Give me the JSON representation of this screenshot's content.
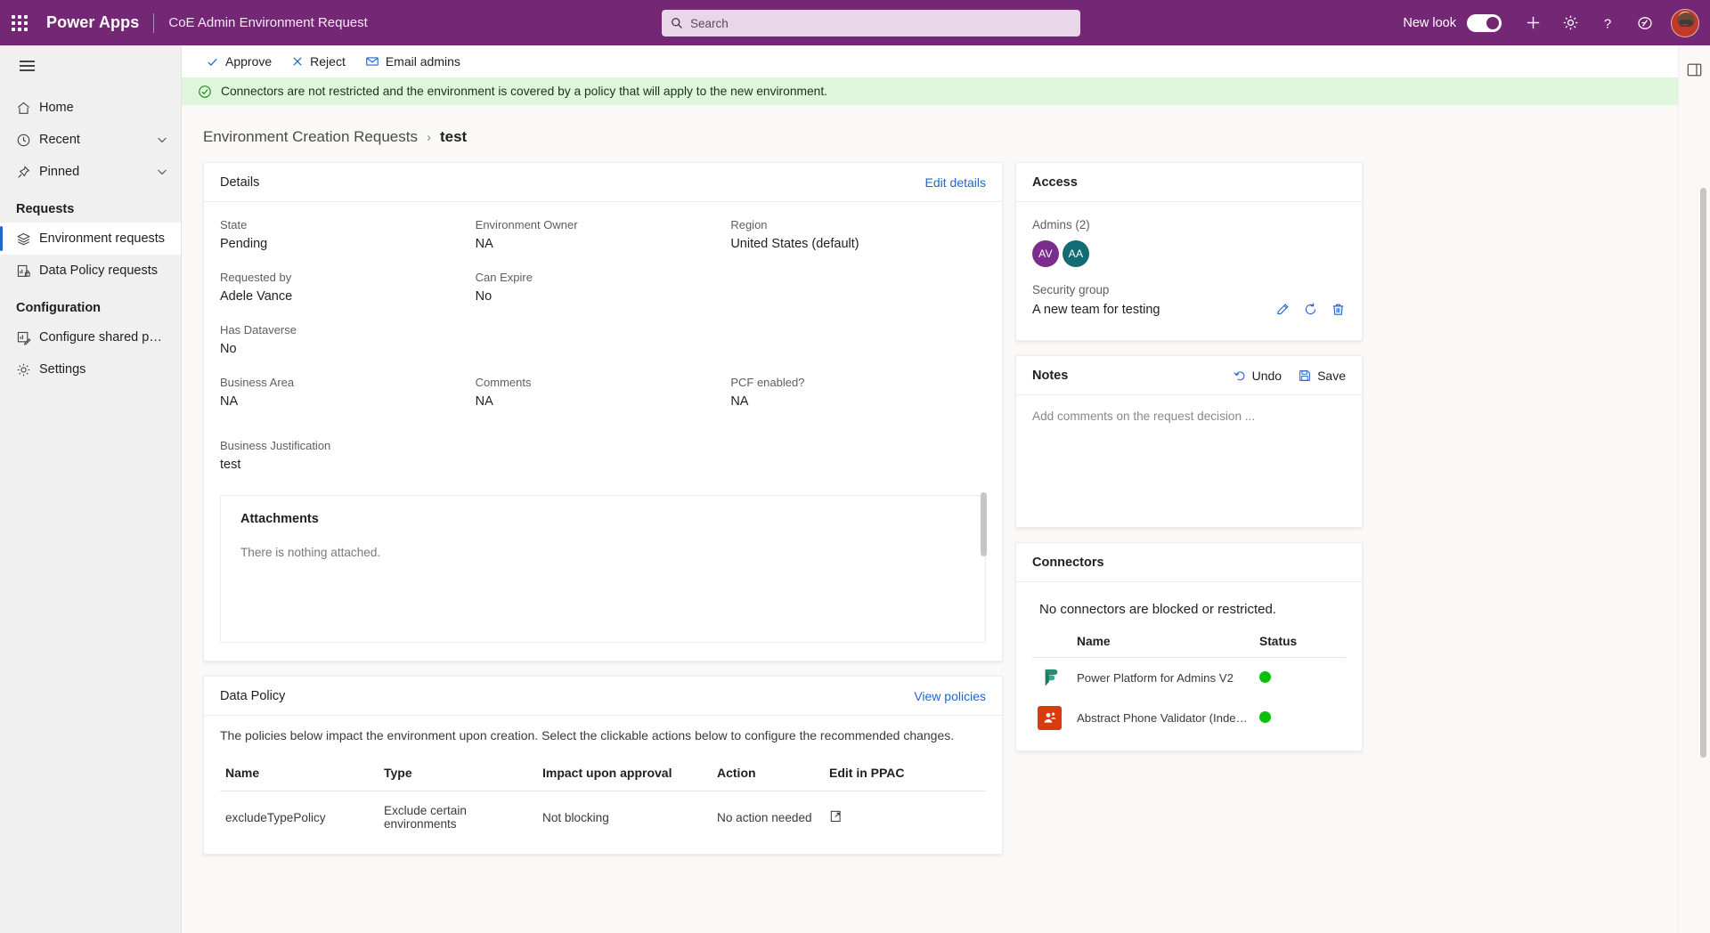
{
  "appbar": {
    "waffle_label": "app-launcher",
    "brand": "Power Apps",
    "app_name": "CoE Admin Environment Request",
    "search_placeholder": "Search",
    "search_value": "",
    "new_look_label": "New look",
    "new_look_on": true
  },
  "sidebar": {
    "items": [
      {
        "label": "Home",
        "icon": "home-icon",
        "expandable": false,
        "selected": false
      },
      {
        "label": "Recent",
        "icon": "clock-icon",
        "expandable": true,
        "selected": false
      },
      {
        "label": "Pinned",
        "icon": "pin-icon",
        "expandable": true,
        "selected": false
      }
    ],
    "groups": [
      {
        "title": "Requests",
        "items": [
          {
            "label": "Environment requests",
            "icon": "layers-icon",
            "selected": true
          },
          {
            "label": "Data Policy requests",
            "icon": "policy-lock-icon",
            "selected": false
          }
        ]
      },
      {
        "title": "Configuration",
        "items": [
          {
            "label": "Configure shared pol...",
            "icon": "configure-icon",
            "selected": false
          },
          {
            "label": "Settings",
            "icon": "gear-icon",
            "selected": false
          }
        ]
      }
    ]
  },
  "commandbar": {
    "approve": "Approve",
    "reject": "Reject",
    "email_admins": "Email admins"
  },
  "banner": {
    "message": "Connectors are not restricted and the environment is covered by a policy that will apply to the new environment."
  },
  "breadcrumb": {
    "parent": "Environment Creation Requests",
    "separator": "›",
    "current": "test"
  },
  "details": {
    "title": "Details",
    "edit_link": "Edit details",
    "fields": [
      {
        "label": "State",
        "value": "Pending"
      },
      {
        "label": "Environment Owner",
        "value": "NA"
      },
      {
        "label": "Region",
        "value": "United States (default)"
      },
      {
        "label": "Requested by",
        "value": "Adele Vance"
      },
      {
        "label": "Can Expire",
        "value": "No"
      },
      {
        "label": "",
        "value": ""
      },
      {
        "label": "Has Dataverse",
        "value": "No"
      },
      {
        "label": "",
        "value": ""
      },
      {
        "label": "",
        "value": ""
      },
      {
        "label": "Business Area",
        "value": "NA"
      },
      {
        "label": "Comments",
        "value": "NA"
      },
      {
        "label": "PCF enabled?",
        "value": "NA"
      }
    ],
    "justification_label": "Business Justification",
    "justification_value": "test",
    "attachments_title": "Attachments",
    "attachments_empty": "There is nothing attached."
  },
  "data_policy": {
    "title": "Data Policy",
    "view_link": "View policies",
    "description": "The policies below impact the environment upon creation. Select the clickable actions below to configure the recommended changes.",
    "columns": [
      "Name",
      "Type",
      "Impact upon approval",
      "Action",
      "Edit in PPAC"
    ],
    "rows": [
      {
        "name": "excludeTypePolicy",
        "type": "Exclude certain environments",
        "impact": "Not blocking",
        "action": "No action needed",
        "edit_icon": "open-in-new-icon"
      }
    ]
  },
  "access": {
    "title": "Access",
    "admins_label": "Admins (2)",
    "admins": [
      {
        "initials": "AV",
        "color": "#7b2d8e"
      },
      {
        "initials": "AA",
        "color": "#136b73"
      }
    ],
    "security_group_label": "Security group",
    "security_group_value": "A new team for testing",
    "actions": [
      "edit-icon",
      "refresh-icon",
      "delete-icon"
    ]
  },
  "notes": {
    "title": "Notes",
    "undo_label": "Undo",
    "save_label": "Save",
    "placeholder": "Add comments on the request decision ...",
    "value": ""
  },
  "connectors": {
    "title": "Connectors",
    "message": "No connectors are blocked or restricted.",
    "columns": [
      "",
      "Name",
      "Status"
    ],
    "rows": [
      {
        "name": "Power Platform for Admins V2",
        "status_color": "#0bbf0b",
        "icon_bg": "#ffffff",
        "icon_kind": "power-platform-icon"
      },
      {
        "name": "Abstract Phone Validator (Indep...",
        "status_color": "#0bbf0b",
        "icon_bg": "#d93b0b",
        "icon_kind": "person-icon"
      }
    ]
  },
  "colors": {
    "brand_purple": "#742774",
    "link_blue": "#2266cc",
    "banner_green_bg": "#dff6dd",
    "status_green": "#0bbf0b"
  }
}
